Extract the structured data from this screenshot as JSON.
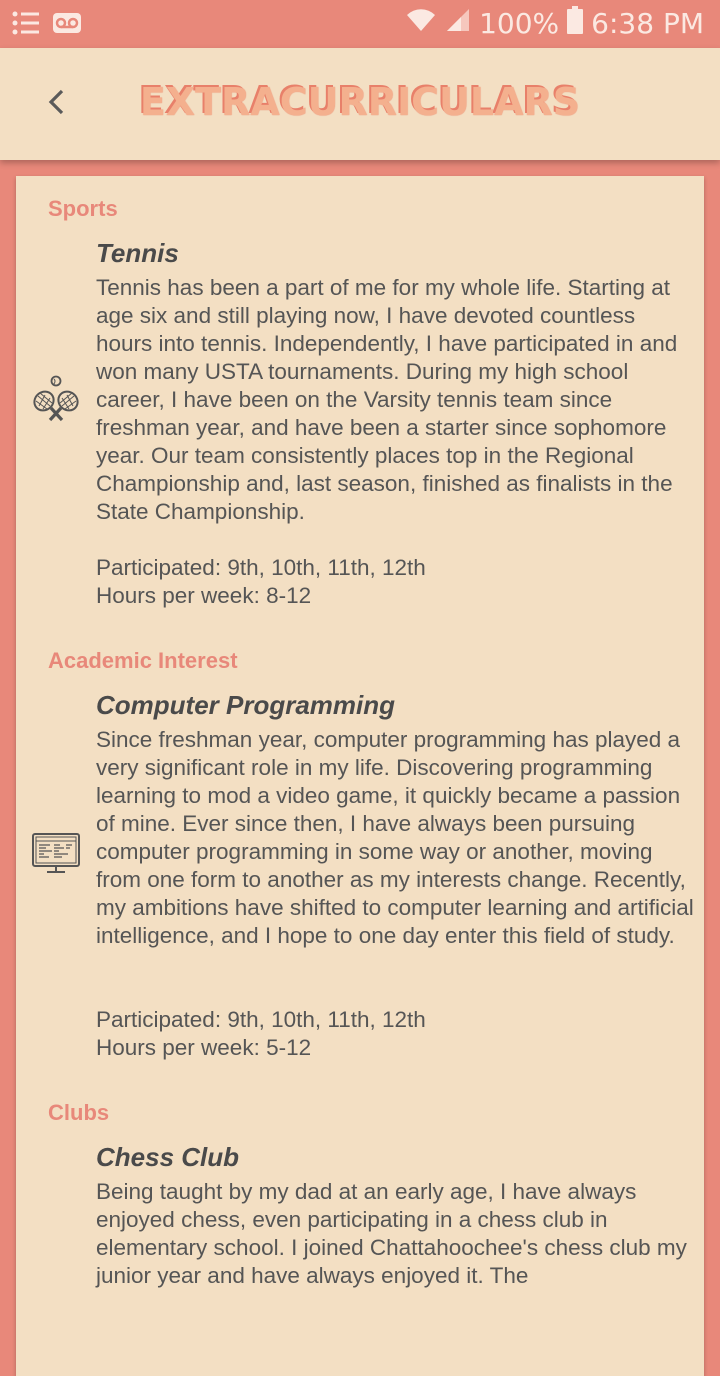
{
  "status_bar": {
    "battery": "100%",
    "time": "6:38 PM",
    "icons": [
      "list-icon",
      "voicemail-icon",
      "wifi-icon",
      "signal-icon",
      "battery-icon"
    ]
  },
  "app_bar": {
    "title": "EXTRACURRICULARS",
    "back_icon": "chevron-left-icon"
  },
  "sections": [
    {
      "title": "Sports",
      "item": {
        "name": "Tennis",
        "icon": "tennis-rackets-icon",
        "description": "Tennis has been a part of me for my whole life. Starting at age six and still playing now, I have devoted countless hours into tennis. Independently, I have participated in and won many USTA tournaments. During my high school career, I have been on the Varsity tennis team since freshman year, and have been a starter since sophomore year. Our team consistently places top in the Regional Championship and, last season, finished as finalists in the State Championship.",
        "participated": "Participated: 9th, 10th, 11th, 12th",
        "hours": "Hours per week: 8-12"
      }
    },
    {
      "title": "Academic Interest",
      "item": {
        "name": "Computer Programming",
        "icon": "computer-screen-icon",
        "description": "Since freshman year, computer programming has played a very significant role in my life. Discovering programming learning to mod a video game, it quickly became a passion of mine. Ever since then, I have always been pursuing computer programming in some way or another, moving from one form to another as my interests change. Recently, my ambitions have shifted to computer learning and artificial intelligence, and I hope to one day enter this field of study.",
        "participated": "Participated: 9th, 10th, 11th, 12th",
        "hours": "Hours per week: 5-12"
      }
    },
    {
      "title": "Clubs",
      "item": {
        "name": "Chess Club",
        "description": "Being taught by my dad at an early age, I have always enjoyed chess, even participating in a chess club in elementary school. I joined Chattahoochee's chess club my junior year and have always enjoyed it. The"
      }
    }
  ],
  "colors": {
    "accent": "#e8887a",
    "background": "#f3dfc3",
    "text": "#555555"
  }
}
